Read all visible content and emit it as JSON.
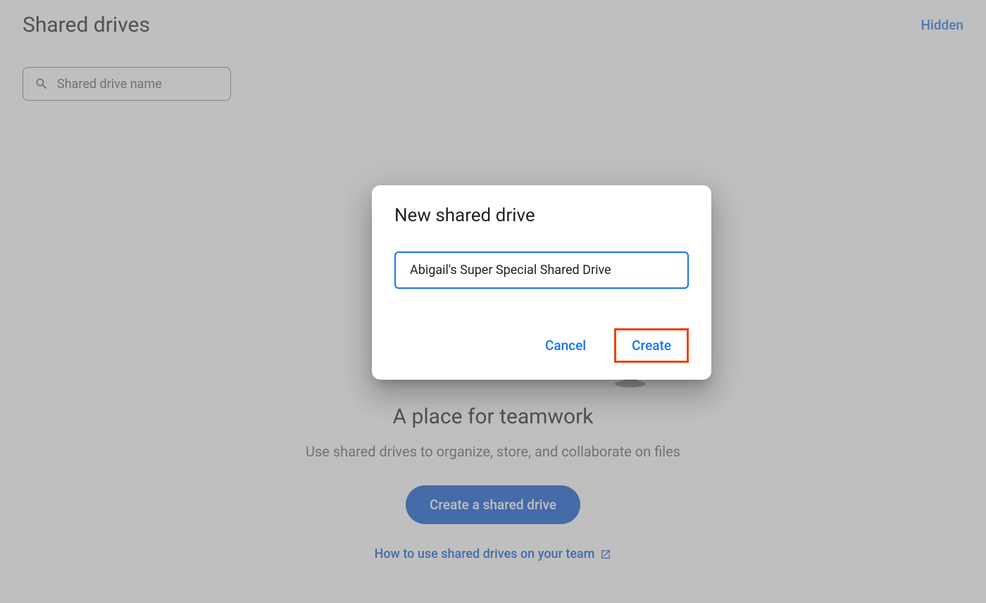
{
  "header": {
    "title": "Shared drives",
    "hidden_link": "Hidden"
  },
  "search": {
    "placeholder": "Shared drive name"
  },
  "empty_state": {
    "title": "A place for teamwork",
    "description": "Use shared drives to organize, store, and collaborate on files",
    "create_button": "Create a shared drive",
    "help_link": "How to use shared drives on your team"
  },
  "dialog": {
    "title": "New shared drive",
    "input_value": "Abigail's Super Special Shared Drive",
    "cancel_label": "Cancel",
    "create_label": "Create"
  }
}
